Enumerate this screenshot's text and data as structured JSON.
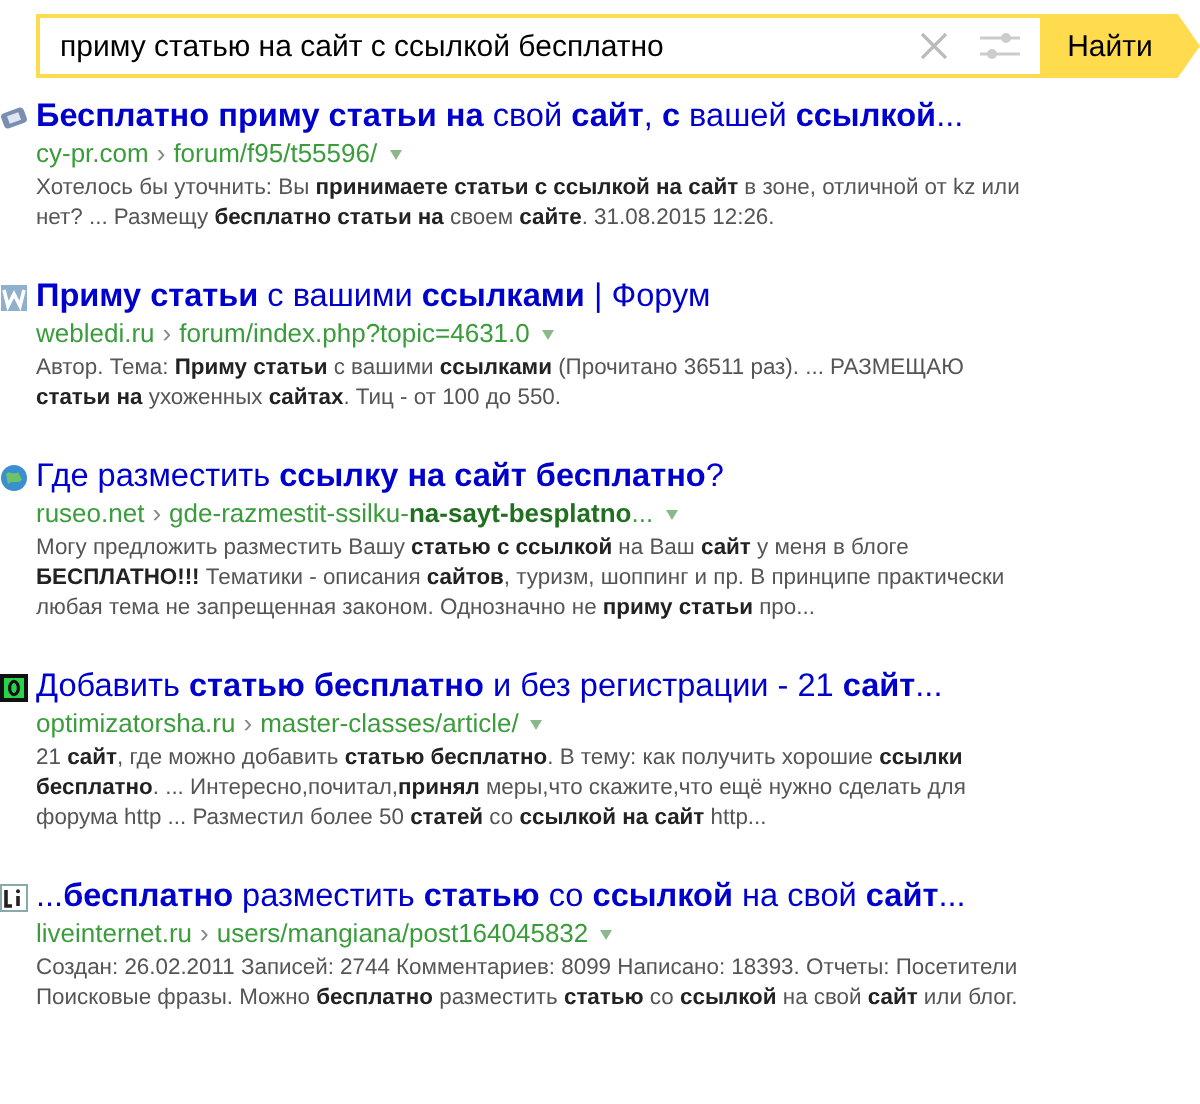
{
  "search": {
    "value": "приму статью на сайт с ссылкой бесплатно",
    "button": "Найти"
  },
  "results": [
    {
      "title": "**Бесплатно приму статьи на** свой **сайт**, **с** вашей **ссылкой**...",
      "domain": "cy-pr.com",
      "separator": "›",
      "path": "forum/f95/t55596/",
      "snippet": "Хотелось бы уточнить: Вы **принимаете статьи с ссылкой на сайт** в зоне, отличной от kz или нет? ... Размещу **бесплатно статьи на** своем **сайте**. 31.08.2015 12:26."
    },
    {
      "title": "**Приму статьи** с вашими **ссылками** | Форум",
      "domain": "webledi.ru",
      "separator": "›",
      "path": "forum/index.php?topic=4631.0",
      "snippet": "Автор. Тема: **Приму статьи** с вашими **ссылками** (Прочитано 36511 раз). ... РАЗМЕЩАЮ **статьи на** ухоженных **сайтах**. Тиц - от 100 до 550."
    },
    {
      "title": "Где разместить **ссылку на сайт бесплатно**?",
      "domain": "ruseo.net",
      "separator": "›",
      "path": "gde-razmestit-ssilku-**na-sayt-besplatno**...",
      "snippet": "Могу предложить разместить Вашу **статью с ссылкой** на Ваш **сайт** у меня в блоге **БЕСПЛАТНО!!!** Тематики - описания **сайтов**, туризм, шоппинг и пр. В принципе практически любая тема не запрещенная законом. Однозначно не **приму статьи** про..."
    },
    {
      "title": "Добавить **статью бесплатно** и без регистрации - 21 **сайт**...",
      "domain": "optimizatorsha.ru",
      "separator": "›",
      "path": "master-classes/article/",
      "snippet": "21 **сайт**, где можно добавить **статью бесплатно**. В тему: как получить хорошие **ссылки бесплатно**. ... Интересно,почитал,**принял** меры,что скажите,что ещё нужно сделать для форума http ... Разместил более 50 **статей** со **ссылкой на сайт** http..."
    },
    {
      "title": "...**бесплатно** разместить **статью** со **ссылкой** на свой **сайт**...",
      "domain": "liveinternet.ru",
      "separator": "›",
      "path": "users/mangiana/post164045832",
      "snippet": "Создан: 26.02.2011 Записей: 2744 Комментариев: 8099 Написано: 18393. Отчеты: Посетители Поисковые фразы. Можно **бесплатно** разместить **статью** со **ссылкой** на свой **сайт** или блог."
    }
  ]
}
